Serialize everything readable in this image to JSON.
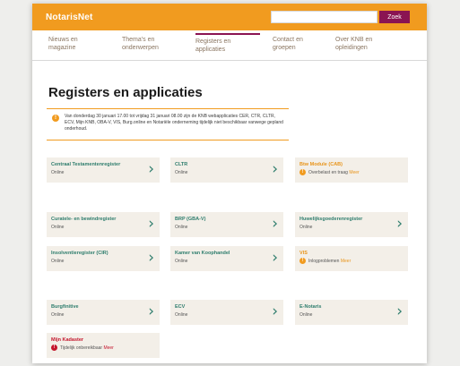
{
  "header": {
    "logo": "NotarisNet",
    "search": {
      "placeholder": "",
      "button_label": "Zoek"
    }
  },
  "nav": [
    {
      "line1": "Nieuws en",
      "line2": "magazine"
    },
    {
      "line1": "Thema's en",
      "line2": "onderwerpen"
    },
    {
      "line1": "Registers en",
      "line2": "applicaties",
      "active": true
    },
    {
      "line1": "Contact en",
      "line2": "groepen"
    },
    {
      "line1": "Over KNB en",
      "line2": "opleidingen"
    }
  ],
  "page_title": "Registers en applicaties",
  "notice": {
    "text": "Van donderdag 30 januari 17.00 tot vrijdag 31 januari 08.00 zijn de KNB webapplicaties CER, CTR, CLTR, ECV, Mijn KNB, OBA-V, VIS, Burg.online en Notariële onderneming tijdelijk niet beschikbaar vanwege gepland onderhoud."
  },
  "tiles": [
    {
      "name": "Centraal Testamentenregister",
      "status": "Online",
      "state": "ok"
    },
    {
      "name": "CLTR",
      "status": "Online",
      "state": "ok"
    },
    {
      "name": "Btw Module (CAB)",
      "status": "Overbelast en traag",
      "more": "Meer",
      "state": "warning"
    },
    {
      "name": "Curatele- en bewindregister",
      "status": "Online",
      "state": "ok"
    },
    {
      "name": "BRP (GBA-V)",
      "status": "Online",
      "state": "ok"
    },
    {
      "name": "Huwelijksgoederenregister",
      "status": "Online",
      "state": "ok"
    },
    {
      "name": "Insolventieregister (CIR)",
      "status": "Online",
      "state": "ok"
    },
    {
      "name": "Kamer van Koophandel",
      "status": "Online",
      "state": "ok"
    },
    {
      "name": "VIS",
      "status": "Inlogproblemen",
      "more": "Meer",
      "state": "warning"
    },
    {
      "name": "Burgfinitive",
      "status": "Online",
      "state": "ok"
    },
    {
      "name": "ECV",
      "status": "Online",
      "state": "ok"
    },
    {
      "name": "E-Notaris",
      "status": "Online",
      "state": "ok"
    },
    {
      "name": "Mijn Kadaster",
      "status": "Tijdelijk onbereikbaar",
      "more": "Meer",
      "state": "error"
    }
  ],
  "colors": {
    "brand_orange": "#f19b1f",
    "accent_purple": "#8a1452",
    "ok_green": "#2e7d6d",
    "error_red": "#c4162d",
    "tile_bg": "#f3efe8"
  },
  "icons": {
    "tile_arrow": "chevron-right-icon",
    "warning": "warning-icon"
  }
}
